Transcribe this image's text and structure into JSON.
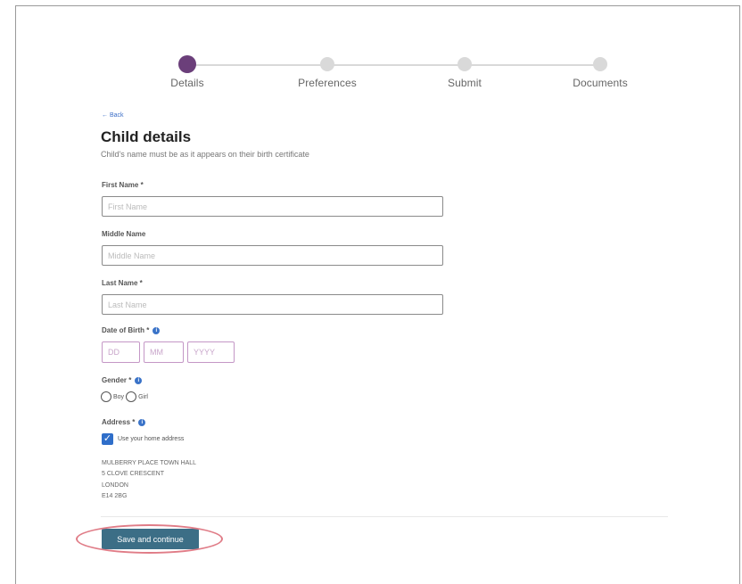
{
  "stepper": {
    "steps": [
      {
        "label": "Details",
        "active": true
      },
      {
        "label": "Preferences",
        "active": false
      },
      {
        "label": "Submit",
        "active": false
      },
      {
        "label": "Documents",
        "active": false
      }
    ]
  },
  "back_link": "← Back",
  "page": {
    "title": "Child details",
    "subtitle": "Child's name must be as it appears on their birth certificate"
  },
  "form": {
    "first_name": {
      "label": "First Name *",
      "placeholder": "First Name",
      "value": ""
    },
    "middle_name": {
      "label": "Middle Name",
      "placeholder": "Middle Name",
      "value": ""
    },
    "last_name": {
      "label": "Last Name *",
      "placeholder": "Last Name",
      "value": ""
    },
    "dob": {
      "label": "Date of Birth *",
      "dd_placeholder": "DD",
      "mm_placeholder": "MM",
      "yyyy_placeholder": "YYYY"
    },
    "gender": {
      "label": "Gender *",
      "options": [
        "Boy",
        "Girl"
      ]
    },
    "address": {
      "label": "Address *",
      "use_home_label": "Use your home address",
      "use_home_checked": true,
      "lines": [
        "MULBERRY PLACE TOWN HALL",
        "5 CLOVE CRESCENT",
        "LONDON",
        "E14 2BG"
      ]
    }
  },
  "actions": {
    "save_label": "Save and continue"
  },
  "icons": {
    "info": "info-icon",
    "check": "check-icon"
  },
  "colors": {
    "accent": "#6b3f7a",
    "button": "#3c6e86",
    "link": "#3c6ec7",
    "highlight": "#e07c87"
  }
}
